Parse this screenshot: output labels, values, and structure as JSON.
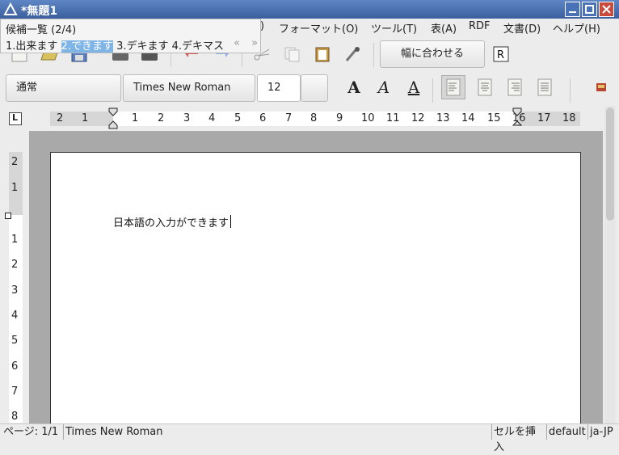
{
  "window": {
    "title": "*無題1"
  },
  "menu": [
    {
      "label": "フォーマット(O)"
    },
    {
      "label": "ツール(T)"
    },
    {
      "label": "表(A)"
    },
    {
      "label": "RDF"
    },
    {
      "label": "文書(D)"
    },
    {
      "label": "ヘルプ(H)"
    }
  ],
  "candidate_popup": {
    "header": "候補一覧 (2/4)",
    "candidates": [
      "1.出来ます",
      "2.できます",
      "3.デキます",
      "4.デキマス"
    ],
    "selected_index": 1,
    "nav_prev": "«",
    "nav_next": "»",
    "partial_menu_text": ")"
  },
  "toolbar": {
    "fit_width_label": "幅に合わせる",
    "style_value": "通常",
    "font_value": "Times New Roman",
    "size_value": "12",
    "bold_glyph": "A",
    "italic_glyph": "A",
    "underline_glyph": "A",
    "ruler_corner_glyph": "L"
  },
  "ruler": {
    "h_labels": [
      "2",
      "1",
      "1",
      "2",
      "3",
      "4",
      "5",
      "6",
      "7",
      "8",
      "9",
      "10",
      "11",
      "12",
      "13",
      "14",
      "15",
      "16",
      "17",
      "18"
    ],
    "v_labels": [
      "2",
      "1",
      "1",
      "2",
      "3",
      "4",
      "5",
      "6",
      "7",
      "8"
    ]
  },
  "document": {
    "text": "日本語の入力ができます"
  },
  "status": {
    "page": "ページ: 1/1",
    "font": "Times New Roman",
    "mode": "セルを挿入",
    "style": "default",
    "lang": "ja-JP"
  },
  "colors": {
    "titlebar": "#3b5f9e",
    "candidate_selected": "#7fb4e6",
    "page_bg": "#a9a9a9"
  }
}
